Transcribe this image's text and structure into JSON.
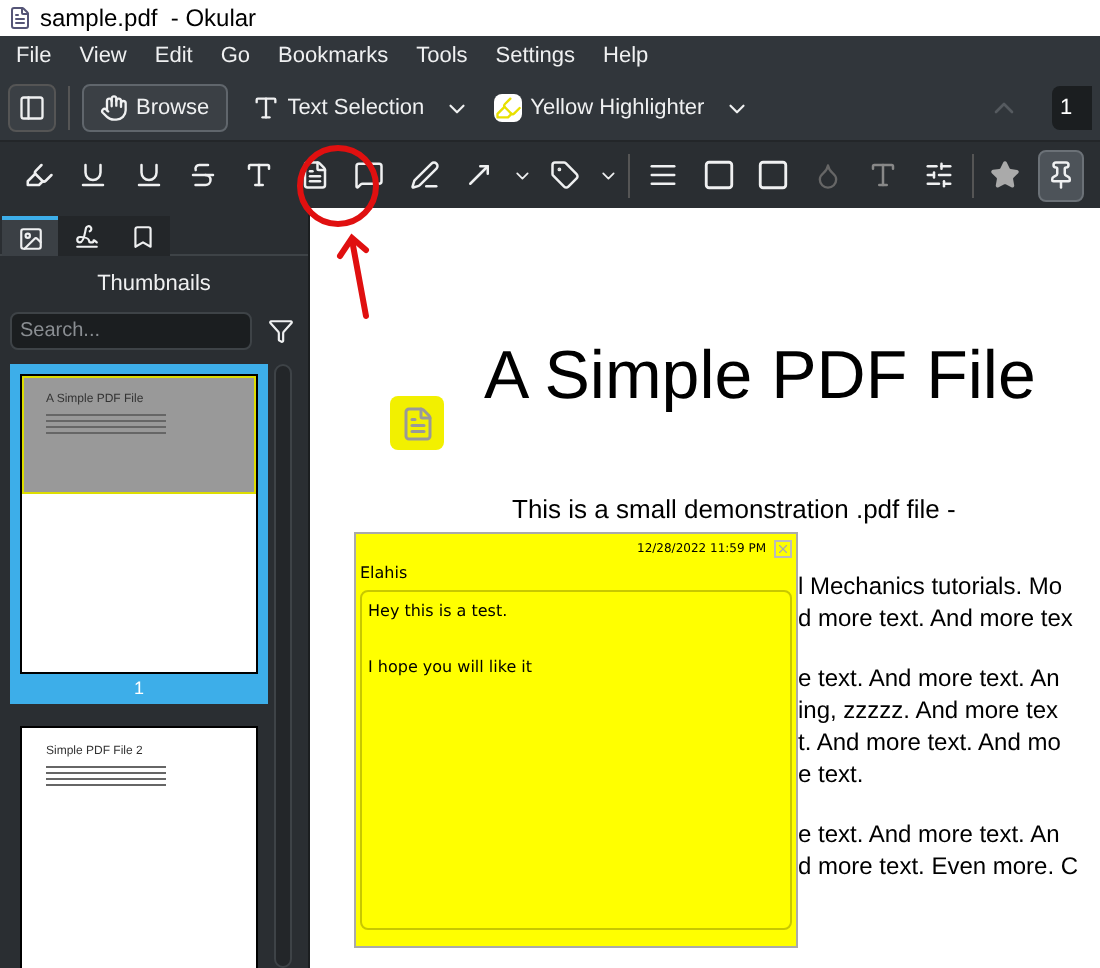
{
  "window": {
    "title": "sample.pdf  - Okular"
  },
  "menu": [
    "File",
    "View",
    "Edit",
    "Go",
    "Bookmarks",
    "Tools",
    "Settings",
    "Help"
  ],
  "tools": [
    {
      "label": "Browse",
      "selected": true
    },
    {
      "label": "Text Selection",
      "selected": false
    },
    {
      "label": "Yellow Highlighter",
      "selected": false
    }
  ],
  "page_field": {
    "value": "1"
  },
  "annotation_toolbar": {
    "pin_selected": true
  },
  "sidebar": {
    "tabs": [
      {
        "selected": true
      },
      {
        "selected": false
      },
      {
        "selected": false
      }
    ],
    "title": "Thumbnails",
    "search": {
      "placeholder": "Search..."
    },
    "thumbnails": [
      {
        "title": "A Simple PDF File",
        "label": "1",
        "selected": true
      },
      {
        "title": "Simple PDF File 2",
        "selected": false
      }
    ]
  },
  "document": {
    "title": "A Simple PDF File",
    "first_line": "This is a small demonstration .pdf file -",
    "visible_paragraphs": [
      [
        "l Mechanics tutorials. Mo",
        "d more text. And more tex"
      ],
      [
        "e text. And more text. An",
        "ing, zzzzz. And more tex",
        "t. And more text. And mo",
        "e text."
      ],
      [
        "e text. And more text. An",
        "d more text. Even more. C"
      ]
    ]
  },
  "note_popup": {
    "date": "12/28/2022 11:59 PM",
    "author": "Elahis",
    "paragraphs": [
      "Hey this is a test.",
      "I hope you will like it"
    ]
  }
}
